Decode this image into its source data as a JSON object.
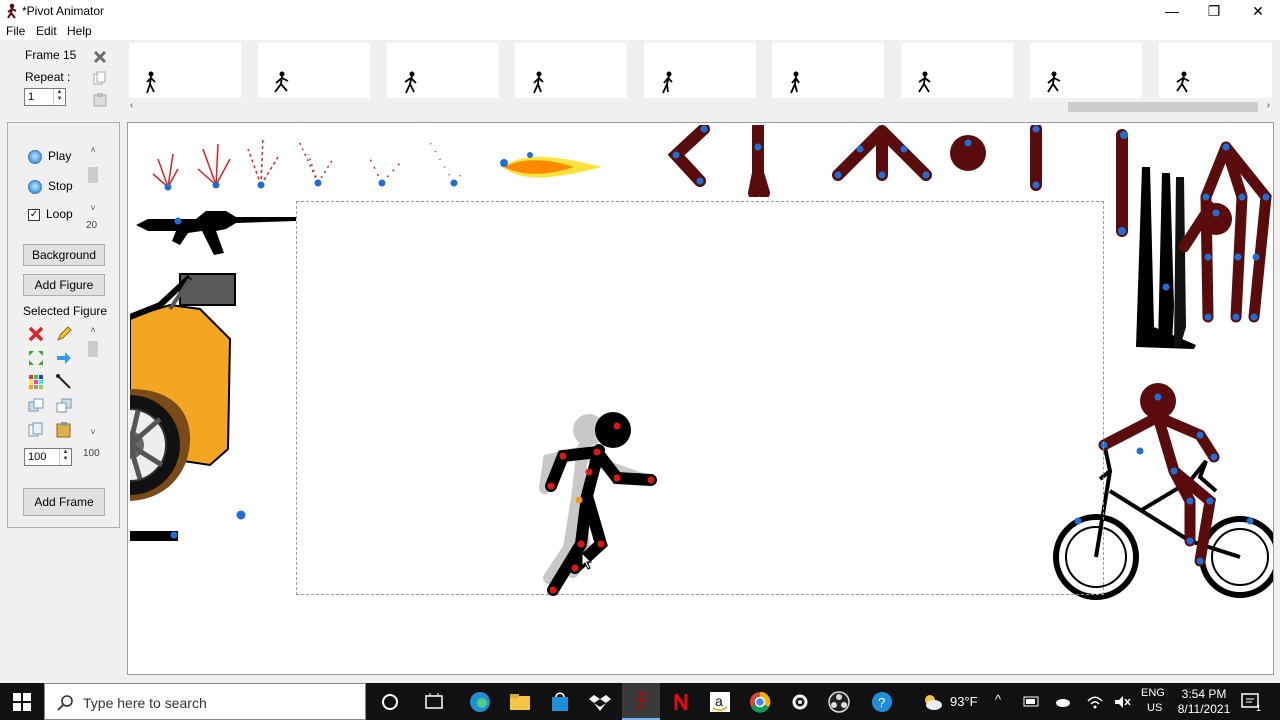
{
  "window": {
    "title": "*Pivot Animator",
    "minimize_icon": "minimize-icon",
    "restore_icon": "restore-icon",
    "close_icon": "close-icon"
  },
  "menu": {
    "file": "File",
    "edit": "Edit",
    "help": "Help"
  },
  "frames_panel": {
    "frame_label": "Frame 15",
    "repeat_label": "Repeat :",
    "repeat_value": "1"
  },
  "playback": {
    "play_label": "Play",
    "stop_label": "Stop",
    "loop_label": "Loop",
    "loop_checked": true,
    "speed_value": "20"
  },
  "buttons": {
    "background": "Background",
    "add_figure": "Add Figure",
    "add_frame": "Add Frame"
  },
  "selected_figure": {
    "title": "Selected Figure",
    "scale_value": "100",
    "scale_max": "100"
  },
  "taskbar": {
    "search_placeholder": "Type here to search",
    "weather": "93°F",
    "language": "ENG",
    "region": "US",
    "time": "3:54 PM",
    "date": "8/11/2021",
    "notification_count": "1"
  },
  "colors": {
    "figure_red": "#5a0b0b",
    "joint_blue": "#1f6fd6",
    "joint_red": "#e01515"
  }
}
